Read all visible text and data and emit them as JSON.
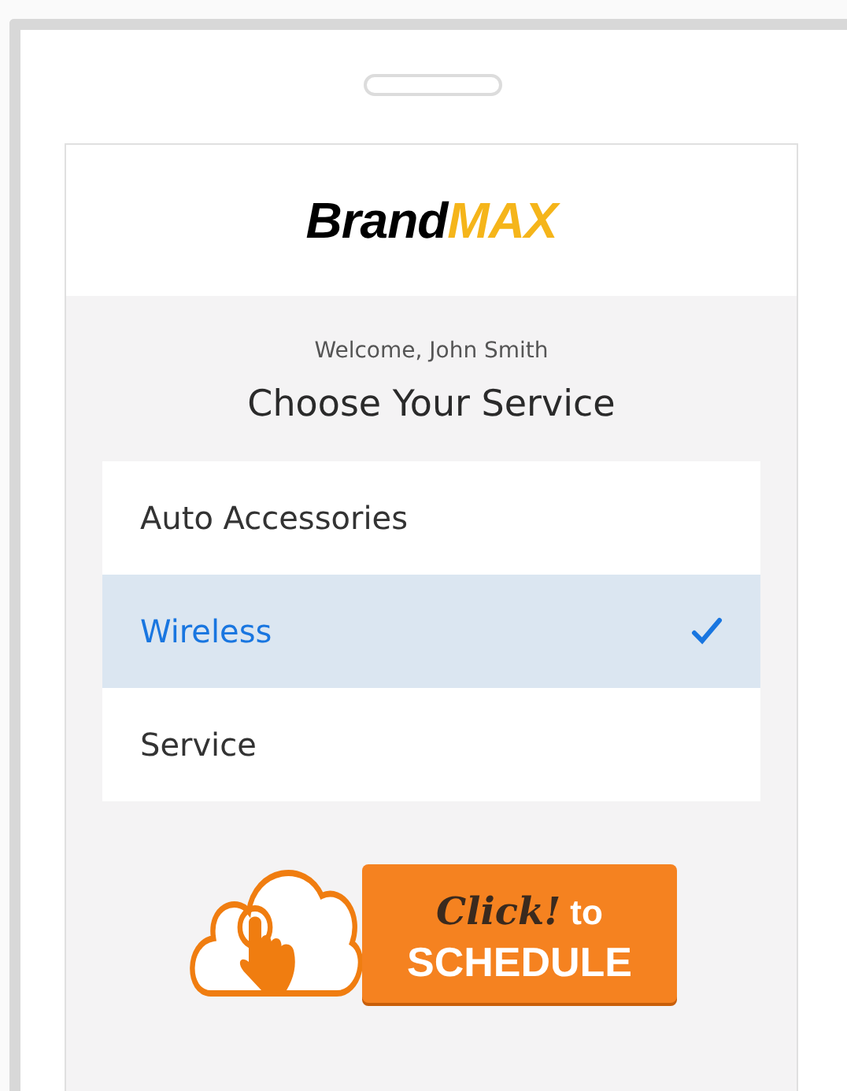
{
  "logo": {
    "brand": "Brand",
    "accent": "MAX"
  },
  "welcome": "Welcome, John Smith",
  "heading": "Choose Your Service",
  "services": [
    {
      "label": "Auto Accessories",
      "selected": false
    },
    {
      "label": "Wireless",
      "selected": true
    },
    {
      "label": "Service",
      "selected": false
    }
  ],
  "schedule_button": {
    "emphasis": "Click!",
    "text_1": "to",
    "text_2": "SCHEDULE"
  }
}
